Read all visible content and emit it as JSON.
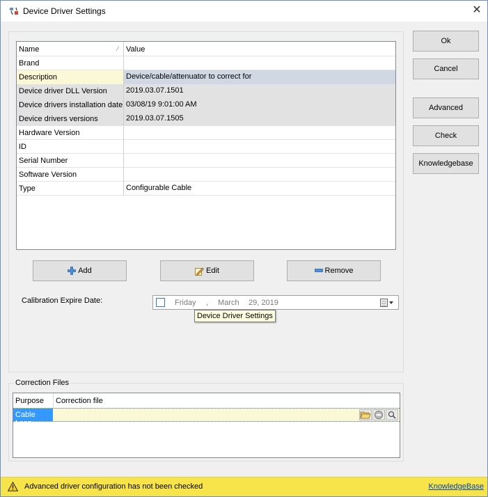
{
  "window": {
    "title": "Device Driver Settings"
  },
  "properties": {
    "headers": {
      "name": "Name",
      "value": "Value"
    },
    "rows": [
      {
        "name": "Brand",
        "value": ""
      },
      {
        "name": "Description",
        "value": "Device/cable/attenuator to correct for"
      },
      {
        "name": "Device driver DLL Version",
        "value": "2019.03.07.1501"
      },
      {
        "name": "Device drivers installation date",
        "value": "03/08/19 9:01:00 AM"
      },
      {
        "name": "Device drivers versions",
        "value": "2019.03.07.1505"
      },
      {
        "name": "Hardware Version",
        "value": ""
      },
      {
        "name": "ID",
        "value": ""
      },
      {
        "name": "Serial Number",
        "value": ""
      },
      {
        "name": "Software Version",
        "value": ""
      },
      {
        "name": "Type",
        "value": "Configurable Cable"
      }
    ]
  },
  "actions": {
    "add": "Add",
    "edit": "Edit",
    "remove": "Remove"
  },
  "side_buttons": {
    "ok": "Ok",
    "cancel": "Cancel",
    "advanced": "Advanced",
    "check": "Check",
    "knowledgebase": "Knowledgebase"
  },
  "calibration": {
    "label": "Calibration Expire Date:",
    "weekday": "Friday",
    "separator": ",",
    "month": "March",
    "day_year": "29, 2019",
    "checked": false
  },
  "tooltip": {
    "text": "Device Driver Settings"
  },
  "correction_files": {
    "title": "Correction Files",
    "headers": {
      "purpose": "Purpose",
      "file": "Correction file"
    },
    "rows": [
      {
        "purpose": "Cable Loss",
        "file": ""
      }
    ]
  },
  "status": {
    "message": "Advanced driver configuration has not been checked",
    "link": "KnowledgeBase"
  },
  "colors": {
    "status_bar": "#f7e44b",
    "selection": "#3399ff",
    "highlight_row": "#fbf8d6",
    "readonly_row": "#e2e2e2"
  },
  "icons": [
    "app-settings-icon",
    "close-icon",
    "sort-icon",
    "add-icon",
    "edit-icon",
    "remove-icon",
    "calendar-icon",
    "open-folder-icon",
    "clear-icon",
    "search-icon",
    "warning-icon"
  ]
}
